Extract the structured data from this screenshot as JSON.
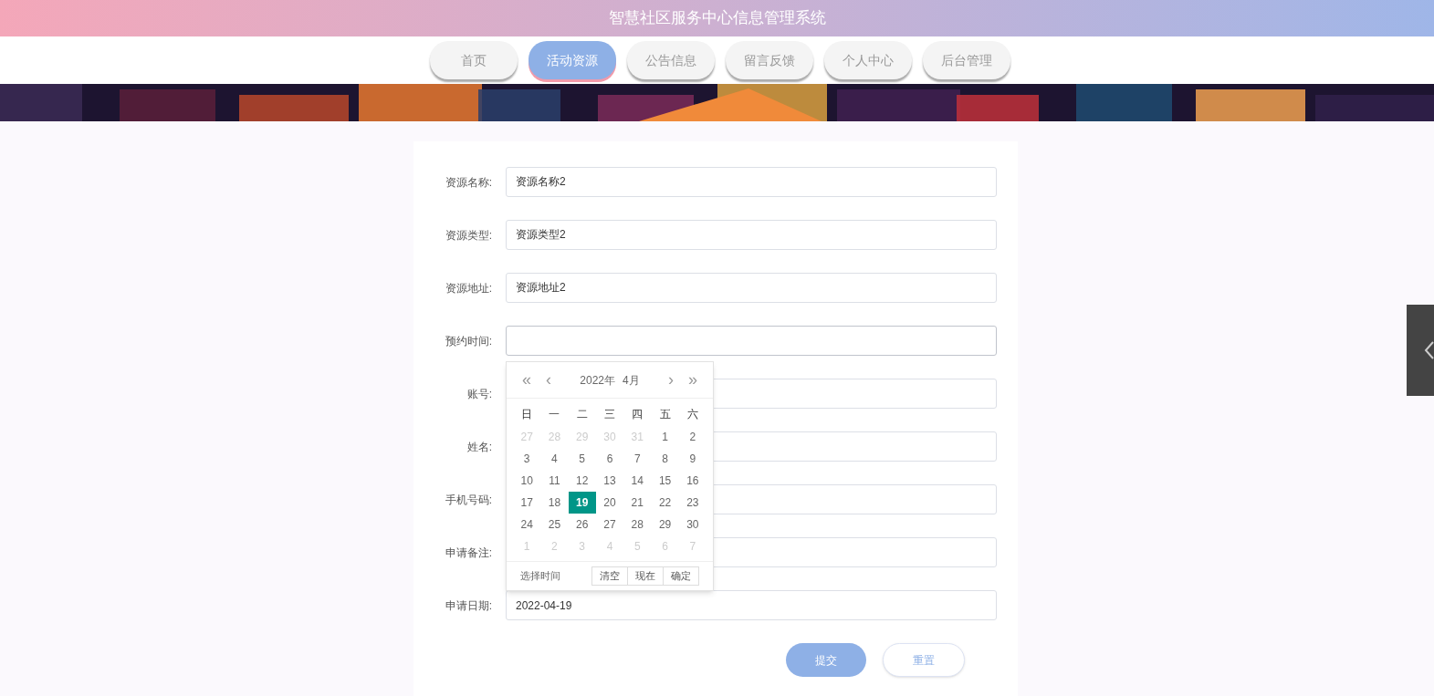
{
  "header": {
    "title": "智慧社区服务中心信息管理系统"
  },
  "nav": [
    {
      "label": "首页",
      "selected": false
    },
    {
      "label": "活动资源",
      "selected": true
    },
    {
      "label": "公告信息",
      "selected": false
    },
    {
      "label": "留言反馈",
      "selected": false
    },
    {
      "label": "个人中心",
      "selected": false
    },
    {
      "label": "后台管理",
      "selected": false
    }
  ],
  "form": {
    "fields": [
      {
        "label": "资源名称:",
        "value": "资源名称2"
      },
      {
        "label": "资源类型:",
        "value": "资源类型2"
      },
      {
        "label": "资源地址:",
        "value": "资源地址2"
      },
      {
        "label": "预约时间:",
        "focused": true
      },
      {
        "label": "账号:"
      },
      {
        "label": "姓名:"
      },
      {
        "label": "手机号码:"
      },
      {
        "label": "申请备注:"
      },
      {
        "label": "申请日期:",
        "value": "2022-04-19"
      }
    ],
    "buttons": [
      {
        "label": "提交",
        "kind": "primary"
      },
      {
        "label": "重置",
        "kind": "secondary"
      }
    ]
  },
  "date_picker": {
    "prev_year": "«",
    "prev_month": "‹",
    "year": "2022年",
    "month": "4月",
    "next_month": "›",
    "next_year": "»",
    "weekdays": [
      "日",
      "一",
      "二",
      "三",
      "四",
      "五",
      "六"
    ],
    "weeks": [
      [
        {
          "day": "27",
          "muted": true,
          "selected": false
        },
        {
          "day": "28",
          "muted": true,
          "selected": false
        },
        {
          "day": "29",
          "muted": true,
          "selected": false
        },
        {
          "day": "30",
          "muted": true,
          "selected": false
        },
        {
          "day": "31",
          "muted": true,
          "selected": false
        },
        {
          "day": "1",
          "muted": false,
          "selected": false
        },
        {
          "day": "2",
          "muted": false,
          "selected": false
        }
      ],
      [
        {
          "day": "3",
          "muted": false,
          "selected": false
        },
        {
          "day": "4",
          "muted": false,
          "selected": false
        },
        {
          "day": "5",
          "muted": false,
          "selected": false
        },
        {
          "day": "6",
          "muted": false,
          "selected": false
        },
        {
          "day": "7",
          "muted": false,
          "selected": false
        },
        {
          "day": "8",
          "muted": false,
          "selected": false
        },
        {
          "day": "9",
          "muted": false,
          "selected": false
        }
      ],
      [
        {
          "day": "10",
          "muted": false,
          "selected": false
        },
        {
          "day": "11",
          "muted": false,
          "selected": false
        },
        {
          "day": "12",
          "muted": false,
          "selected": false
        },
        {
          "day": "13",
          "muted": false,
          "selected": false
        },
        {
          "day": "14",
          "muted": false,
          "selected": false
        },
        {
          "day": "15",
          "muted": false,
          "selected": false
        },
        {
          "day": "16",
          "muted": false,
          "selected": false
        }
      ],
      [
        {
          "day": "17",
          "muted": false,
          "selected": false
        },
        {
          "day": "18",
          "muted": false,
          "selected": false
        },
        {
          "day": "19",
          "muted": false,
          "selected": true
        },
        {
          "day": "20",
          "muted": false,
          "selected": false
        },
        {
          "day": "21",
          "muted": false,
          "selected": false
        },
        {
          "day": "22",
          "muted": false,
          "selected": false
        },
        {
          "day": "23",
          "muted": false,
          "selected": false
        }
      ],
      [
        {
          "day": "24",
          "muted": false,
          "selected": false
        },
        {
          "day": "25",
          "muted": false,
          "selected": false
        },
        {
          "day": "26",
          "muted": false,
          "selected": false
        },
        {
          "day": "27",
          "muted": false,
          "selected": false
        },
        {
          "day": "28",
          "muted": false,
          "selected": false
        },
        {
          "day": "29",
          "muted": false,
          "selected": false
        },
        {
          "day": "30",
          "muted": false,
          "selected": false
        }
      ],
      [
        {
          "day": "1",
          "muted": true,
          "selected": false
        },
        {
          "day": "2",
          "muted": true,
          "selected": false
        },
        {
          "day": "3",
          "muted": true,
          "selected": false
        },
        {
          "day": "4",
          "muted": true,
          "selected": false
        },
        {
          "day": "5",
          "muted": true,
          "selected": false
        },
        {
          "day": "6",
          "muted": true,
          "selected": false
        },
        {
          "day": "7",
          "muted": true,
          "selected": false
        }
      ]
    ],
    "time_link": "选择时间",
    "actions": [
      "清空",
      "现在",
      "确定"
    ]
  }
}
